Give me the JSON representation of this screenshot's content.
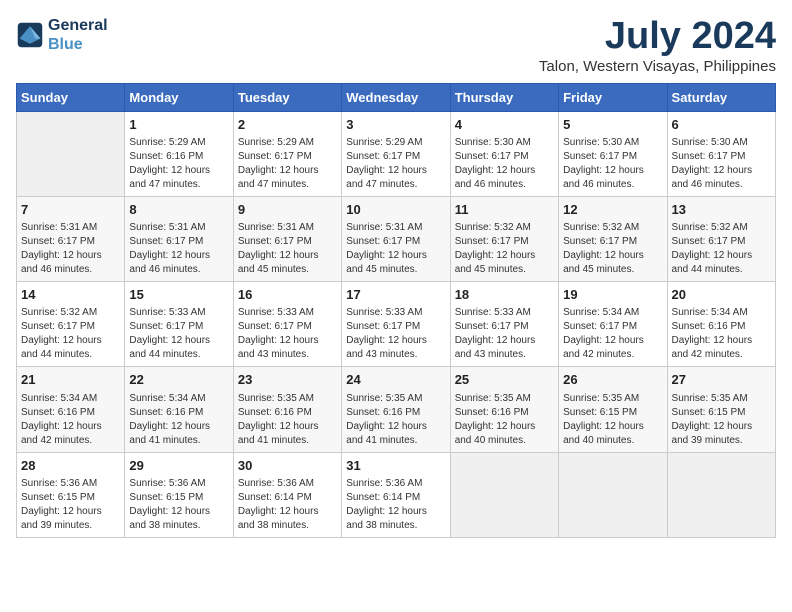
{
  "header": {
    "logo_line1": "General",
    "logo_line2": "Blue",
    "month_year": "July 2024",
    "location": "Talon, Western Visayas, Philippines"
  },
  "days_of_week": [
    "Sunday",
    "Monday",
    "Tuesday",
    "Wednesday",
    "Thursday",
    "Friday",
    "Saturday"
  ],
  "weeks": [
    [
      {
        "day": "",
        "content": ""
      },
      {
        "day": "1",
        "content": "Sunrise: 5:29 AM\nSunset: 6:16 PM\nDaylight: 12 hours\nand 47 minutes."
      },
      {
        "day": "2",
        "content": "Sunrise: 5:29 AM\nSunset: 6:17 PM\nDaylight: 12 hours\nand 47 minutes."
      },
      {
        "day": "3",
        "content": "Sunrise: 5:29 AM\nSunset: 6:17 PM\nDaylight: 12 hours\nand 47 minutes."
      },
      {
        "day": "4",
        "content": "Sunrise: 5:30 AM\nSunset: 6:17 PM\nDaylight: 12 hours\nand 46 minutes."
      },
      {
        "day": "5",
        "content": "Sunrise: 5:30 AM\nSunset: 6:17 PM\nDaylight: 12 hours\nand 46 minutes."
      },
      {
        "day": "6",
        "content": "Sunrise: 5:30 AM\nSunset: 6:17 PM\nDaylight: 12 hours\nand 46 minutes."
      }
    ],
    [
      {
        "day": "7",
        "content": "Sunrise: 5:31 AM\nSunset: 6:17 PM\nDaylight: 12 hours\nand 46 minutes."
      },
      {
        "day": "8",
        "content": "Sunrise: 5:31 AM\nSunset: 6:17 PM\nDaylight: 12 hours\nand 46 minutes."
      },
      {
        "day": "9",
        "content": "Sunrise: 5:31 AM\nSunset: 6:17 PM\nDaylight: 12 hours\nand 45 minutes."
      },
      {
        "day": "10",
        "content": "Sunrise: 5:31 AM\nSunset: 6:17 PM\nDaylight: 12 hours\nand 45 minutes."
      },
      {
        "day": "11",
        "content": "Sunrise: 5:32 AM\nSunset: 6:17 PM\nDaylight: 12 hours\nand 45 minutes."
      },
      {
        "day": "12",
        "content": "Sunrise: 5:32 AM\nSunset: 6:17 PM\nDaylight: 12 hours\nand 45 minutes."
      },
      {
        "day": "13",
        "content": "Sunrise: 5:32 AM\nSunset: 6:17 PM\nDaylight: 12 hours\nand 44 minutes."
      }
    ],
    [
      {
        "day": "14",
        "content": "Sunrise: 5:32 AM\nSunset: 6:17 PM\nDaylight: 12 hours\nand 44 minutes."
      },
      {
        "day": "15",
        "content": "Sunrise: 5:33 AM\nSunset: 6:17 PM\nDaylight: 12 hours\nand 44 minutes."
      },
      {
        "day": "16",
        "content": "Sunrise: 5:33 AM\nSunset: 6:17 PM\nDaylight: 12 hours\nand 43 minutes."
      },
      {
        "day": "17",
        "content": "Sunrise: 5:33 AM\nSunset: 6:17 PM\nDaylight: 12 hours\nand 43 minutes."
      },
      {
        "day": "18",
        "content": "Sunrise: 5:33 AM\nSunset: 6:17 PM\nDaylight: 12 hours\nand 43 minutes."
      },
      {
        "day": "19",
        "content": "Sunrise: 5:34 AM\nSunset: 6:17 PM\nDaylight: 12 hours\nand 42 minutes."
      },
      {
        "day": "20",
        "content": "Sunrise: 5:34 AM\nSunset: 6:16 PM\nDaylight: 12 hours\nand 42 minutes."
      }
    ],
    [
      {
        "day": "21",
        "content": "Sunrise: 5:34 AM\nSunset: 6:16 PM\nDaylight: 12 hours\nand 42 minutes."
      },
      {
        "day": "22",
        "content": "Sunrise: 5:34 AM\nSunset: 6:16 PM\nDaylight: 12 hours\nand 41 minutes."
      },
      {
        "day": "23",
        "content": "Sunrise: 5:35 AM\nSunset: 6:16 PM\nDaylight: 12 hours\nand 41 minutes."
      },
      {
        "day": "24",
        "content": "Sunrise: 5:35 AM\nSunset: 6:16 PM\nDaylight: 12 hours\nand 41 minutes."
      },
      {
        "day": "25",
        "content": "Sunrise: 5:35 AM\nSunset: 6:16 PM\nDaylight: 12 hours\nand 40 minutes."
      },
      {
        "day": "26",
        "content": "Sunrise: 5:35 AM\nSunset: 6:15 PM\nDaylight: 12 hours\nand 40 minutes."
      },
      {
        "day": "27",
        "content": "Sunrise: 5:35 AM\nSunset: 6:15 PM\nDaylight: 12 hours\nand 39 minutes."
      }
    ],
    [
      {
        "day": "28",
        "content": "Sunrise: 5:36 AM\nSunset: 6:15 PM\nDaylight: 12 hours\nand 39 minutes."
      },
      {
        "day": "29",
        "content": "Sunrise: 5:36 AM\nSunset: 6:15 PM\nDaylight: 12 hours\nand 38 minutes."
      },
      {
        "day": "30",
        "content": "Sunrise: 5:36 AM\nSunset: 6:14 PM\nDaylight: 12 hours\nand 38 minutes."
      },
      {
        "day": "31",
        "content": "Sunrise: 5:36 AM\nSunset: 6:14 PM\nDaylight: 12 hours\nand 38 minutes."
      },
      {
        "day": "",
        "content": ""
      },
      {
        "day": "",
        "content": ""
      },
      {
        "day": "",
        "content": ""
      }
    ]
  ]
}
